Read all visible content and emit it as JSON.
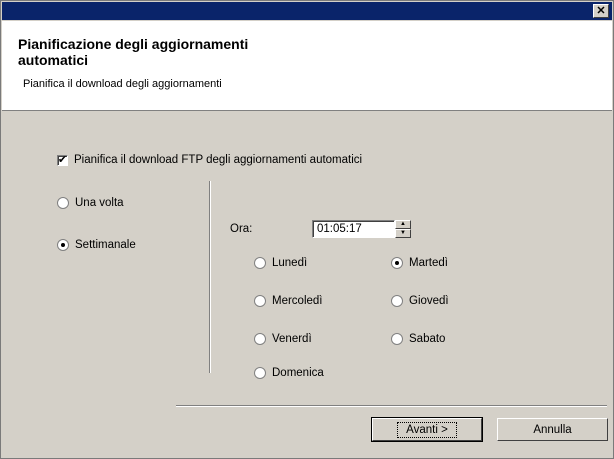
{
  "window": {
    "close_glyph": "✕"
  },
  "header": {
    "title": "Pianificazione degli aggiornamenti automatici",
    "subtitle": "Pianifica il download degli aggiornamenti"
  },
  "schedule": {
    "enable_label": "Pianifica il download FTP degli aggiornamenti automatici",
    "enable_checked": true,
    "once_label": "Una volta",
    "weekly_label": "Settimanale",
    "frequency_selected": "Settimanale",
    "time_label": "Ora:",
    "time_value": "01:05:17",
    "days": {
      "mon": "Lunedì",
      "tue": "Martedì",
      "wed": "Mercoledì",
      "thu": "Giovedì",
      "fri": "Venerdì",
      "sat": "Sabato",
      "sun": "Domenica"
    },
    "day_selected": "Martedì"
  },
  "buttons": {
    "next_label": "Avanti >",
    "cancel_label": "Annulla"
  }
}
